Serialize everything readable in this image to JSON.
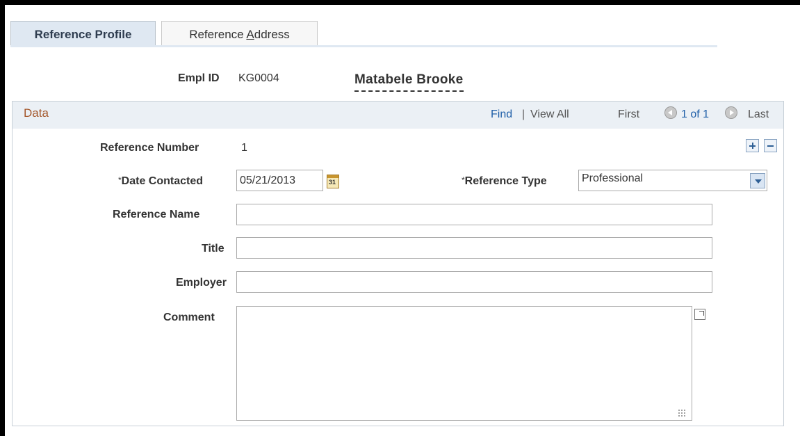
{
  "tabs": [
    {
      "label": "Reference Profile",
      "active": true
    },
    {
      "label_pre": "Reference ",
      "label_accel": "A",
      "label_post": "ddress",
      "active": false
    }
  ],
  "header": {
    "emplid_label": "Empl ID",
    "emplid_value": "KG0004",
    "employee_name": "Matabele Brooke"
  },
  "data_section": {
    "title": "Data",
    "nav": {
      "find": "Find",
      "separator": "|",
      "view_all": "View All",
      "first": "First",
      "count": "1 of 1",
      "last": "Last"
    }
  },
  "form": {
    "reference_number_label": "Reference Number",
    "reference_number_value": "1",
    "date_contacted_label": "Date Contacted",
    "date_contacted_value": "05/21/2013",
    "calendar_day": "31",
    "required_mark": "*",
    "reference_type_label": "Reference Type",
    "reference_type_value": "Professional",
    "reference_name_label": "Reference Name",
    "reference_name_value": "",
    "title_label": "Title",
    "title_value": "",
    "employer_label": "Employer",
    "employer_value": "",
    "comment_label": "Comment",
    "comment_value": ""
  },
  "colors": {
    "active_tab_bg": "#dfe8f2",
    "section_title": "#a4572b",
    "link": "#1f5fa8",
    "header_bar": "#ebf0f5"
  }
}
